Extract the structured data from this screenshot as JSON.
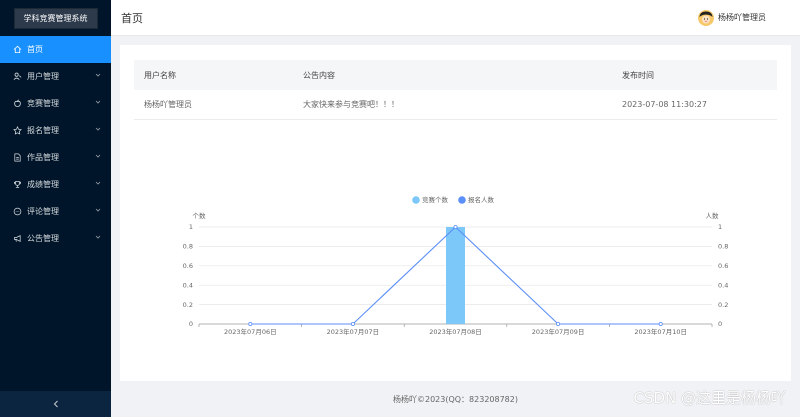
{
  "app": {
    "title": "学科竞赛管理系统"
  },
  "sidebar": {
    "items": [
      {
        "label": "首页",
        "icon": "home-icon",
        "active": true,
        "expandable": false
      },
      {
        "label": "用户管理",
        "icon": "user-icon",
        "active": false,
        "expandable": true
      },
      {
        "label": "竞赛管理",
        "icon": "apple-icon",
        "active": false,
        "expandable": true
      },
      {
        "label": "报名管理",
        "icon": "star-icon",
        "active": false,
        "expandable": true
      },
      {
        "label": "作品管理",
        "icon": "document-icon",
        "active": false,
        "expandable": true
      },
      {
        "label": "成绩管理",
        "icon": "trophy-icon",
        "active": false,
        "expandable": true
      },
      {
        "label": "评论管理",
        "icon": "chat-icon",
        "active": false,
        "expandable": true
      },
      {
        "label": "公告管理",
        "icon": "megaphone-icon",
        "active": false,
        "expandable": true
      }
    ]
  },
  "header": {
    "page_title": "首页",
    "user_name": "杨杨吖管理员"
  },
  "announcements": {
    "columns": [
      "用户名称",
      "公告内容",
      "发布时间"
    ],
    "rows": [
      [
        "杨杨吖管理员",
        "大家快来参与竞赛吧！！！",
        "2023-07-08 11:30:27"
      ]
    ]
  },
  "chart_data": {
    "type": "bar",
    "categories": [
      "2023年07月06日",
      "2023年07月07日",
      "2023年07月08日",
      "2023年07月09日",
      "2023年07月10日"
    ],
    "series": [
      {
        "name": "竞赛个数",
        "type": "bar",
        "axis": "left",
        "color": "#7cc8f8",
        "values": [
          0,
          0,
          1,
          0,
          0
        ]
      },
      {
        "name": "报名人数",
        "type": "line",
        "axis": "right",
        "color": "#5b8ff9",
        "values": [
          0,
          0,
          1,
          0,
          0
        ]
      }
    ],
    "ylabel_left": "个数",
    "ylabel_right": "人数",
    "yticks": [
      "0",
      "0.2",
      "0.4",
      "0.6",
      "0.8",
      "1"
    ],
    "ylim": [
      0,
      1
    ],
    "grid": true,
    "legend": "top-center"
  },
  "footer": {
    "text": "杨杨吖©2023(QQ：823208782)"
  },
  "watermark": {
    "text": "CSDN @这里是杨杨吖"
  }
}
